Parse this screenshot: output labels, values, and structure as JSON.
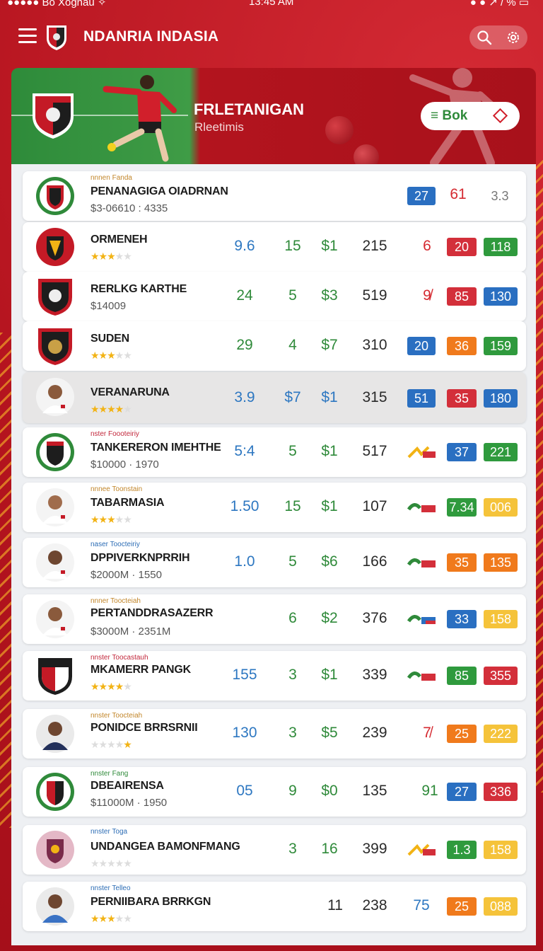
{
  "status": {
    "left": "●●●●● Bo Xognau ✧",
    "center": "13:45 AM",
    "right": "● ● ↗ / % ▭"
  },
  "app": {
    "title": "NDANRIA INDASIA"
  },
  "hero": {
    "title": "FRLETANIGAN",
    "subtitle": "Rleetimis",
    "book_label": "≡ Bok"
  },
  "rows": [
    {
      "tag": "nnnen Fanda",
      "name": "PENANAGIGA OIADRNAN",
      "sub": "$3-06610 : 4335",
      "cols": [
        "",
        "",
        "",
        ""
      ],
      "chips": [
        "27",
        "61",
        "3.3"
      ]
    },
    {
      "tag": "",
      "name": "ORMENEH",
      "stars": "3.5",
      "cols": [
        "9.6",
        "15",
        "$1",
        "215"
      ],
      "extra": "6",
      "chips": [
        "20",
        "118"
      ]
    },
    {
      "tag": "",
      "name": "RERLKG KARTHE",
      "sub": "$14009",
      "cols": [
        "24",
        "5",
        "$3",
        "519"
      ],
      "extra": "9̸",
      "chips": [
        "85",
        "130"
      ]
    },
    {
      "tag": "",
      "name": "SUDEN",
      "stars": "3",
      "cols": [
        "29",
        "4",
        "$7",
        "310"
      ],
      "chips": [
        "20",
        "36",
        "159"
      ]
    },
    {
      "tag": "",
      "name": "VERANARUNA",
      "stars": "4",
      "cols": [
        "3.9",
        "$7",
        "$1",
        "315"
      ],
      "chips": [
        "51",
        "35",
        "180"
      ]
    },
    {
      "tag": "nster Foooteiriy",
      "name": "TANKERERON IMEHTHE",
      "sub": "$10000 · 1970",
      "cols": [
        "5:4",
        "5",
        "$1",
        "517"
      ],
      "chips": [
        "37",
        "221"
      ]
    },
    {
      "tag": "nnnee Toonstain",
      "name": "TABARMASIA",
      "stars": "3.5",
      "cols": [
        "1.50",
        "15",
        "$1",
        "107"
      ],
      "chips": [
        "7.34",
        "006"
      ]
    },
    {
      "tag": "naser Toocteiriy",
      "name": "DPPIVERKNPRRIH",
      "sub": "$2000M · 1550",
      "cols": [
        "1.0",
        "5",
        "$6",
        "166"
      ],
      "chips": [
        "35",
        "135"
      ]
    },
    {
      "tag": "nnner Toocteiah",
      "name": "PERTANDDRASAZERR",
      "sub": "$3000M · 2351M",
      "cols": [
        "",
        "6",
        "$2",
        "376"
      ],
      "chips": [
        "33",
        "158"
      ]
    },
    {
      "tag": "nnster Toocastauh",
      "name": "MKAMERR PANGK",
      "stars": "4",
      "cols": [
        "155",
        "3",
        "$1",
        "339"
      ],
      "chips": [
        "85",
        "355"
      ]
    },
    {
      "tag": "nnster Toocteiah",
      "name": "PONIDCE BRRSRNII",
      "stars": "0",
      "cols": [
        "130",
        "3",
        "$5",
        "239"
      ],
      "extra": "7̸",
      "chips": [
        "25",
        "222"
      ]
    },
    {
      "tag": "nnster Fang",
      "name": "DBEAIRENSA",
      "sub": "$11000M · 1950",
      "cols": [
        "05",
        "9",
        "$0",
        "135"
      ],
      "extra": "91",
      "chips": [
        "27",
        "336"
      ]
    },
    {
      "tag": "nnster Toga",
      "name": "UNDANGEA BAMONFMANG",
      "stars": "0",
      "cols": [
        "",
        "3",
        "16",
        "399"
      ],
      "chips": [
        "1.3",
        "158"
      ]
    },
    {
      "tag": "nnster Telleo",
      "name": "PERNIIBARA BRRKGN",
      "stars": "3",
      "cols": [
        "",
        "",
        "11",
        "238"
      ],
      "extra": "75",
      "chips": [
        "25",
        "088"
      ]
    }
  ],
  "colors": {
    "brand_red": "#c41a26",
    "accent_green": "#2f8a3a",
    "chip_blue": "#2a6fc1",
    "chip_orange": "#f07a1c",
    "chip_yellow": "#f5c33a"
  },
  "icons": {
    "menu": "hamburger-icon",
    "search": "search-icon",
    "settings": "gear-icon"
  }
}
